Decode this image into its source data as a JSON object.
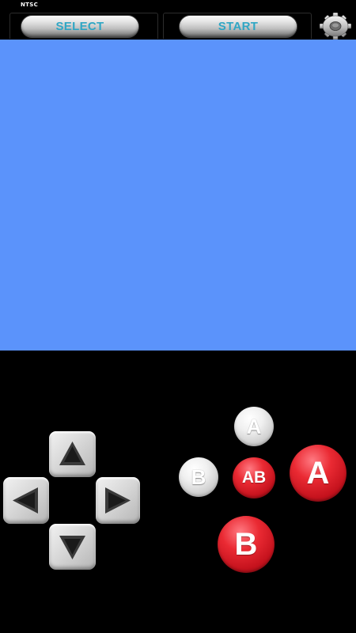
{
  "topbar": {
    "region": "NTSC",
    "select_label": "SELECT",
    "start_label": "START",
    "settings_icon": "gear-icon"
  },
  "screen": {
    "color": "#5b93fb"
  },
  "dpad": {
    "up_icon": "triangle-up-icon",
    "down_icon": "triangle-down-icon",
    "left_icon": "triangle-left-icon",
    "right_icon": "triangle-right-icon"
  },
  "buttons": {
    "turbo_a_label": "A",
    "turbo_b_label": "B",
    "ab_label": "AB",
    "a_label": "A",
    "b_label": "B"
  },
  "colors": {
    "background": "#000000",
    "button_text": "#2fa6c4",
    "red_button": "#e0202b",
    "white_button": "#e8e8e8"
  }
}
